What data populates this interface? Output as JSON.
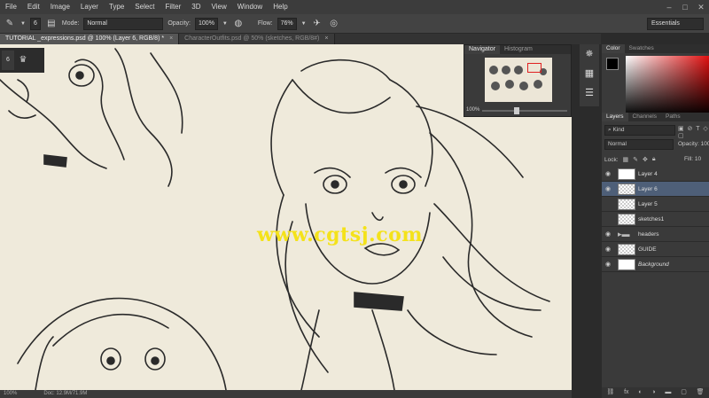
{
  "menu": [
    "File",
    "Edit",
    "Image",
    "Layer",
    "Type",
    "Select",
    "Filter",
    "3D",
    "View",
    "Window",
    "Help"
  ],
  "options": {
    "brush_size": "6",
    "mode_label": "Mode:",
    "mode_value": "Normal",
    "opacity_label": "Opacity:",
    "opacity_value": "100%",
    "flow_label": "Flow:",
    "flow_value": "76%",
    "workspace": "Essentials"
  },
  "tabs": [
    {
      "label": "TUTORIAL _expressions.psd @ 100% (Layer 6, RGB/8) *",
      "active": true
    },
    {
      "label": "CharacterOutfits.psd @ 50% (sketches, RGB/8#)",
      "active": false
    }
  ],
  "tool_badge": {
    "size": "6"
  },
  "watermark": "www.cgtsj.com",
  "navigator": {
    "tabs": [
      "Navigator",
      "Histogram"
    ],
    "zoom": "100%"
  },
  "color_panel": {
    "tabs": [
      "Color",
      "Swatches"
    ]
  },
  "layers_panel": {
    "tabs": [
      "Layers",
      "Channels",
      "Paths"
    ],
    "kind": "Kind",
    "blend_mode": "Normal",
    "opacity_label": "Opacity:",
    "opacity_value": "100",
    "lock_label": "Lock:",
    "fill_label": "Fill:",
    "fill_value": "10",
    "layers": [
      {
        "name": "Layer 4",
        "visible": true,
        "selected": false,
        "type": "drawing"
      },
      {
        "name": "Layer 6",
        "visible": true,
        "selected": true,
        "type": "empty"
      },
      {
        "name": "Layer 5",
        "visible": false,
        "selected": false,
        "type": "empty"
      },
      {
        "name": "sketches1",
        "visible": false,
        "selected": false,
        "type": "empty"
      },
      {
        "name": "headers",
        "visible": true,
        "selected": false,
        "type": "folder"
      },
      {
        "name": "GUIDE",
        "visible": true,
        "selected": false,
        "type": "empty"
      },
      {
        "name": "Background",
        "visible": true,
        "selected": false,
        "type": "solid",
        "italic": true
      }
    ]
  },
  "status": {
    "zoom": "100%",
    "doc": "Doc: 12.9M/71.9M"
  },
  "colors": {
    "accent_selected": "#4e5f78",
    "watermark": "#f4e21a",
    "canvas_paper": "#efeadb"
  }
}
